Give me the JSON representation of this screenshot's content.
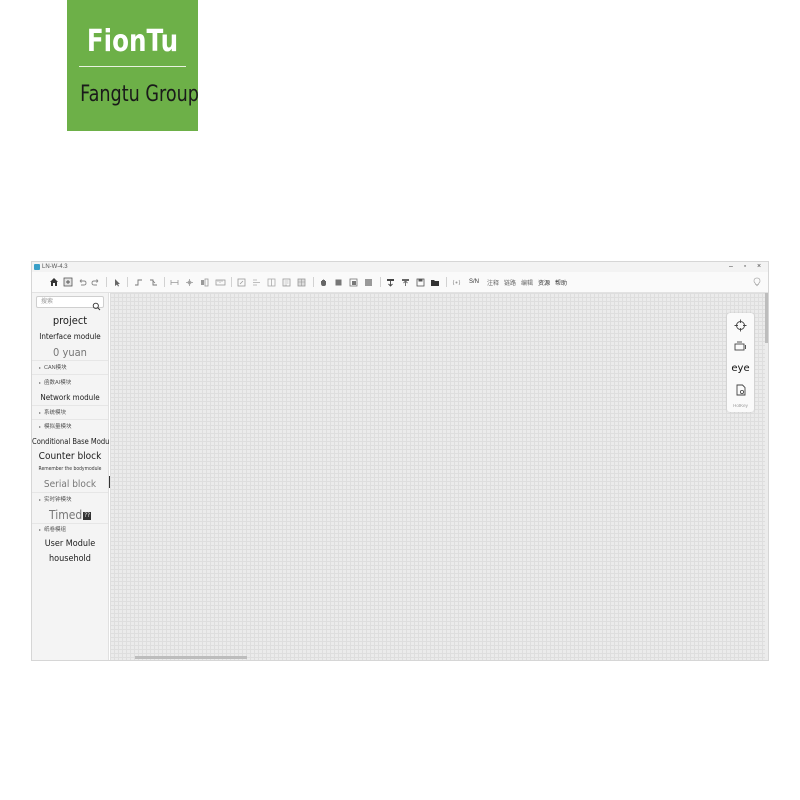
{
  "logo": {
    "title": "FionTu",
    "subtitle": "Fangtu Group",
    "background": "#6db048"
  },
  "window": {
    "title": "LN-W-4.3",
    "controls": {
      "minimize": "–",
      "maximize": "▫",
      "close": "×"
    }
  },
  "toolbar": {
    "icons": [
      "home-icon",
      "add-page-icon",
      "undo-icon",
      "redo-icon",
      "select-arrow-icon",
      "rising-edge-icon",
      "falling-edge-icon",
      "h-connect-icon",
      "cross-connect-icon",
      "parallel-icon",
      "ruler-icon",
      "edit-icon",
      "align-icon",
      "split-icon",
      "list-icon",
      "table-icon",
      "hand-icon",
      "zoom-fit-icon",
      "zoom-in-icon",
      "zoom-out-icon",
      "download-icon",
      "upload-icon",
      "save-icon",
      "open-folder-icon",
      "signal-icon"
    ],
    "text_items": {
      "sn": "S/N",
      "annotate": "注释",
      "link": "链路",
      "compile": "编辑",
      "resources": "资源",
      "help": "帮助"
    }
  },
  "sidebar": {
    "search_placeholder": "搜索",
    "items": [
      {
        "label": "project",
        "kind": "heading"
      },
      {
        "label": "Interface module",
        "kind": "heading"
      },
      {
        "label": "0 yuan",
        "kind": "heading-light"
      },
      {
        "label": "CAN模块",
        "kind": "sub"
      },
      {
        "label": "函数AI模块",
        "kind": "sub"
      },
      {
        "label": "Network module",
        "kind": "heading"
      },
      {
        "label": "系统模块",
        "kind": "sub"
      },
      {
        "label": "模拟量模块",
        "kind": "sub"
      },
      {
        "label": "Conditional Base Module",
        "kind": "heading"
      },
      {
        "label": "Counter block",
        "kind": "heading"
      },
      {
        "label": "Remember the bodymodule",
        "kind": "tiny"
      },
      {
        "label": "Serial block",
        "kind": "heading-light"
      },
      {
        "label": "实时钟模块",
        "kind": "sub"
      },
      {
        "label": "Timed",
        "kind": "heading-light"
      },
      {
        "label": "纸卷模组",
        "kind": "sub"
      },
      {
        "label": "User Module",
        "kind": "heading"
      },
      {
        "label": "household",
        "kind": "heading"
      }
    ],
    "timed_badge": "??"
  },
  "float_panel": {
    "eye_label": "eye",
    "footer": "HotKey"
  }
}
